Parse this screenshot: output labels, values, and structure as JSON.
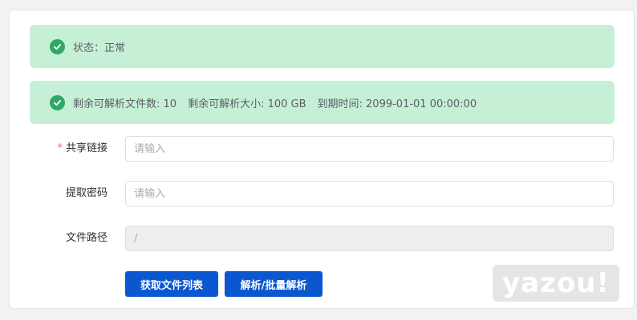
{
  "status_alert": {
    "text": "状态：正常"
  },
  "quota_alert": {
    "files_remaining": "剩余可解析文件数: 10",
    "size_remaining": "剩余可解析大小: 100 GB",
    "expiry": "到期时间: 2099-01-01 00:00:00"
  },
  "form": {
    "share_link": {
      "required_mark": "*",
      "label": "共享链接",
      "placeholder": "请输入",
      "value": ""
    },
    "extract_code": {
      "label": "提取密码",
      "placeholder": "请输入",
      "value": ""
    },
    "file_path": {
      "label": "文件路径",
      "value": "/"
    }
  },
  "buttons": {
    "get_list": "获取文件列表",
    "parse": "解析/批量解析"
  },
  "watermark": "yazou!",
  "colors": {
    "alert_bg": "#c6f0d6",
    "success": "#2fa866",
    "primary": "#0b57d0",
    "required": "#f56c6c"
  },
  "icons": {
    "alert": "check-circle-icon"
  }
}
